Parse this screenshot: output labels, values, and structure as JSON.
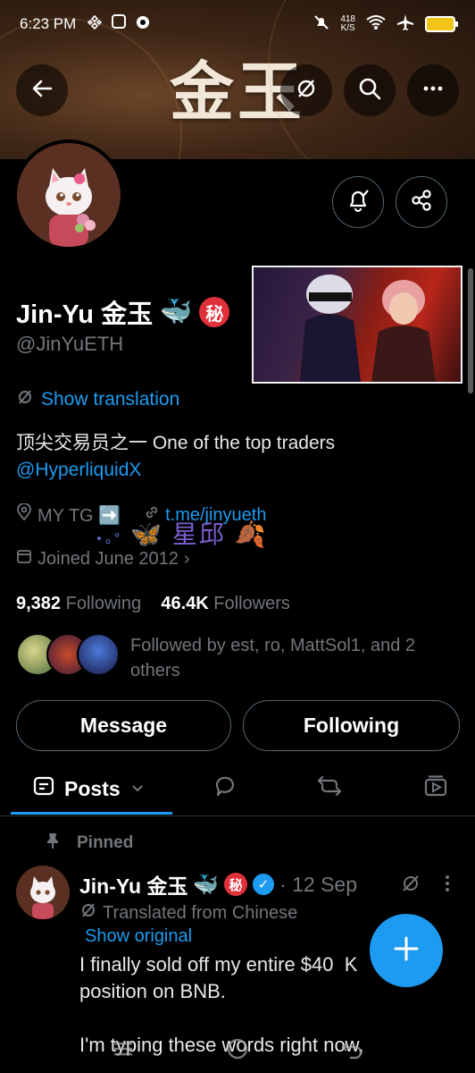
{
  "status_bar": {
    "time": "6:23 PM",
    "net_speed_value": "418",
    "net_speed_unit": "K/S",
    "icons_left": [
      "binance-icon",
      "app-icon",
      "settings-icon"
    ],
    "icons_right": [
      "mute-icon",
      "wifi-icon",
      "airplane-icon",
      "battery-icon"
    ]
  },
  "banner": {
    "title": "金玉"
  },
  "header": {
    "back_icon": "back-arrow-icon",
    "translate_icon": "translate-icon",
    "search_icon": "search-icon",
    "more_icon": "more-icon"
  },
  "profile": {
    "name": "Jin-Yu 金玉",
    "emoji_whale": "🐳",
    "emoji_secret": "秘",
    "handle": "@JinYuETH",
    "show_translation": "Show translation",
    "bio_line1": "顶尖交易员之一 One of the top traders",
    "bio_link": "@HyperliquidX",
    "location": "MY TG ➡️",
    "website": "t.me/jinyueth",
    "joined": "Joined June 2012",
    "decoration": "星邱",
    "following_count": "9,382",
    "following_label": "Following",
    "followers_count": "46.4K",
    "followers_label": "Followers",
    "followed_by": "Followed by est, ro, MattSol1, and 2 others"
  },
  "actions": {
    "message": "Message",
    "following": "Following"
  },
  "tabs": [
    {
      "label": "Posts",
      "active": true
    },
    {
      "label": "",
      "icon": "reply-icon"
    },
    {
      "label": "",
      "icon": "repost-icon"
    },
    {
      "label": "",
      "icon": "media-icon"
    }
  ],
  "pinned_post": {
    "pinned_label": "Pinned",
    "author": "Jin-Yu 金玉",
    "date": "· 12 Sep",
    "translated_from": "Translated from Chinese",
    "show_original": "Show original",
    "body": "I finally sold off my entire $40  K\nposition on BNB.\n\nI'm typing these words right now,"
  },
  "colors": {
    "accent": "#1d9bf0",
    "muted": "#71767b",
    "background": "#000000"
  }
}
